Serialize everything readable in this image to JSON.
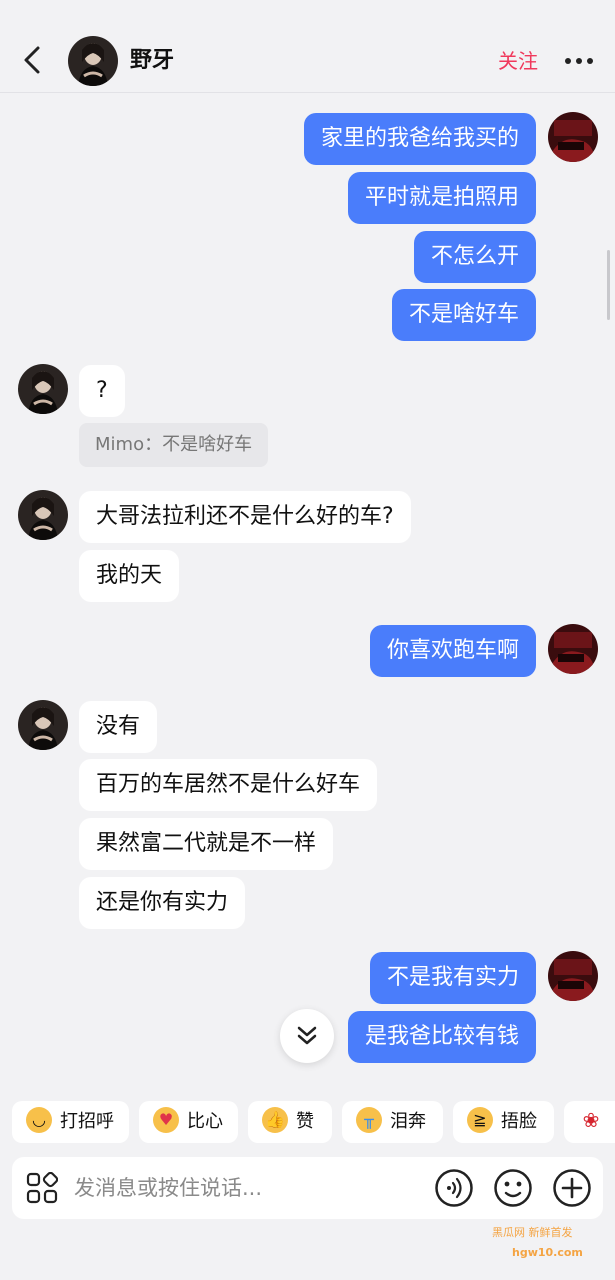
{
  "header": {
    "name": "野牙",
    "follow_label": "关注"
  },
  "messages": [
    {
      "from": "me",
      "text": "家里的我爸给我买的"
    },
    {
      "from": "me",
      "text": "平时就是拍照用"
    },
    {
      "from": "me",
      "text": "不怎么开"
    },
    {
      "from": "me",
      "text": "不是啥好车"
    },
    {
      "from": "other",
      "text": "?"
    },
    {
      "from": "other",
      "text": "大哥法拉利还不是什么好的车?"
    },
    {
      "from": "other",
      "text": "我的天"
    },
    {
      "from": "me",
      "text": "你喜欢跑车啊"
    },
    {
      "from": "other",
      "text": "没有"
    },
    {
      "from": "other",
      "text": "百万的车居然不是什么好车"
    },
    {
      "from": "other",
      "text": "果然富二代就是不一样"
    },
    {
      "from": "other",
      "text": "还是你有实力"
    },
    {
      "from": "me",
      "text": "不是我有实力"
    },
    {
      "from": "me",
      "text": "是我爸比较有钱"
    }
  ],
  "quote": {
    "text": "Mimo：不是啥好车"
  },
  "quick_replies": [
    {
      "label": "打招呼",
      "icon": "waving-face-icon"
    },
    {
      "label": "比心",
      "icon": "heart-hands-icon"
    },
    {
      "label": "赞",
      "icon": "thumbs-up-icon"
    },
    {
      "label": "泪奔",
      "icon": "crying-face-icon"
    },
    {
      "label": "捂脸",
      "icon": "laughing-face-icon"
    },
    {
      "label": "",
      "icon": "rose-icon"
    }
  ],
  "input": {
    "placeholder": "发消息或按住说话..."
  },
  "watermark": {
    "line1": "黑瓜网 新鲜首发",
    "line2": "hgw10.com"
  },
  "colors": {
    "my_bubble": "#4a7dfb",
    "follow": "#f0395c",
    "background": "#f2f2f4"
  }
}
